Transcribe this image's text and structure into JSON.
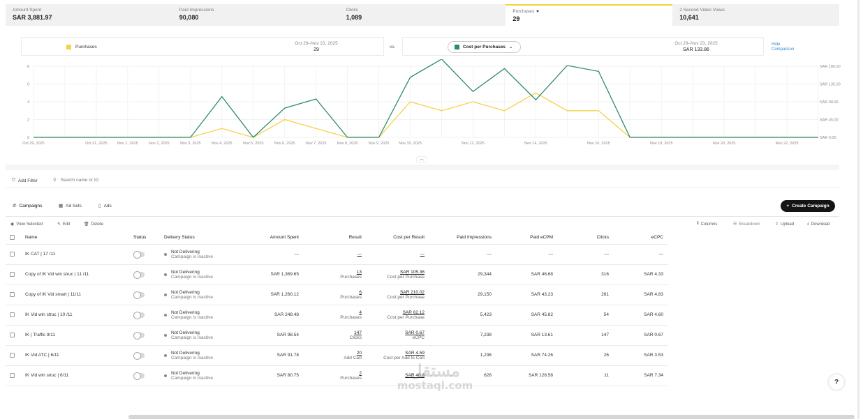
{
  "metrics": [
    {
      "label": "Amount Spent",
      "value": "SAR 3,881.97"
    },
    {
      "label": "Paid Impressions",
      "value": "90,080"
    },
    {
      "label": "Clicks",
      "value": "1,089"
    },
    {
      "label": "Purchases",
      "value": "29"
    },
    {
      "label": "2 Second Video Views",
      "value": "10,641"
    }
  ],
  "comparison": {
    "left_metric": "Purchases",
    "left_period": "Oct 29–Nov 23, 2025",
    "left_value": "29",
    "vs": "vs.",
    "right_metric": "Cost per Purchases",
    "right_period": "Oct 29–Nov 23, 2025",
    "right_value": "SAR 133.86",
    "hide_label": "Hide Comparison"
  },
  "colors": {
    "purchases": "#f3d34a",
    "cost_per_purchase": "#2e8b6e"
  },
  "chart_data": {
    "type": "line",
    "x": [
      "Oct 29, 2025",
      "Oct 30, 2025",
      "Oct 31, 2025",
      "Nov 1, 2025",
      "Nov 2, 2025",
      "Nov 3, 2025",
      "Nov 4, 2025",
      "Nov 5, 2025",
      "Nov 6, 2025",
      "Nov 7, 2025",
      "Nov 8, 2025",
      "Nov 9, 2025",
      "Nov 10, 2025",
      "Nov 11, 2025",
      "Nov 12, 2025",
      "Nov 13, 2025",
      "Nov 14, 2025",
      "Nov 15, 2025",
      "Nov 16, 2025",
      "Nov 17, 2025",
      "Nov 18, 2025",
      "Nov 19, 2025",
      "Nov 20, 2025",
      "Nov 21, 2025",
      "Nov 22, 2025",
      "Nov 23, 2025"
    ],
    "x_tick_labels": [
      "Oct 29, 2025",
      "Oct 31, 2025",
      "Nov 1, 2025",
      "Nov 2, 2025",
      "Nov 3, 2025",
      "Nov 4, 2025",
      "Nov 5, 2025",
      "Nov 6, 2025",
      "Nov 7, 2025",
      "Nov 8, 2025",
      "Nov 9, 2025",
      "Nov 10, 2025",
      "Nov 12, 2025",
      "Nov 14, 2025",
      "Nov 16, 2025",
      "Nov 18, 2025",
      "Nov 20, 2025",
      "Nov 22, 2025"
    ],
    "series": [
      {
        "name": "Purchases",
        "axis": "left",
        "values": [
          0,
          0,
          0,
          0,
          0,
          0,
          1,
          0,
          2,
          1,
          0,
          0,
          4,
          3,
          4,
          3,
          5,
          3,
          3,
          0,
          0,
          0,
          0,
          0,
          0,
          0
        ]
      },
      {
        "name": "Cost per Purchases",
        "axis": "right",
        "values": [
          0,
          0,
          0,
          0,
          0,
          0,
          103,
          0,
          74,
          97,
          0,
          0,
          152,
          198,
          116,
          174,
          95,
          182,
          167,
          0,
          0,
          0,
          0,
          0,
          0,
          0
        ]
      }
    ],
    "ylim_left": [
      0,
      8
    ],
    "yticks_left": [
      "0",
      "2",
      "4",
      "6",
      "8"
    ],
    "ylim_right": [
      0,
      180
    ],
    "yticks_right": [
      "SAR 0.00",
      "SAR 45.00",
      "SAR 90.00",
      "SAR 135.00",
      "SAR 180.00"
    ],
    "grid": true
  },
  "toolbar": {
    "add_filter": "Add Filter",
    "search_placeholder": "Search name or ID"
  },
  "tabs": [
    "Campaigns",
    "Ad Sets",
    "Ads"
  ],
  "create_label": "Create Campaign",
  "actions": {
    "view": "View Selected",
    "edit": "Edit",
    "delete": "Delete",
    "columns": "Columns",
    "breakdown": "Breakdown",
    "upload": "Upload",
    "download": "Download"
  },
  "table": {
    "headers": [
      "Name",
      "Status",
      "Delivery Status",
      "Amount Spent",
      "Result",
      "Cost per Result",
      "Paid Impressions",
      "Paid eCPM",
      "Clicks",
      "eCPC"
    ],
    "rows": [
      {
        "name": "IK CAT | 17 /11",
        "del1": "Not Delivering",
        "del2": "Campaign is inactive",
        "spent": "—",
        "res": "—",
        "res_sub": "",
        "cpr": "—",
        "cpr_sub": "",
        "impr": "—",
        "ecpm": "—",
        "clicks": "—",
        "ecpc": "—"
      },
      {
        "name": "Copy of IK Vid win struc | 11 /11",
        "del1": "Not Delivering",
        "del2": "Campaign is inactive",
        "spent": "SAR 1,369.65",
        "res": "13",
        "res_sub": "Purchases",
        "cpr": "SAR 105.36",
        "cpr_sub": "Cost per Purchase",
        "impr": "29,344",
        "ecpm": "SAR 46.68",
        "clicks": "316",
        "ecpc": "SAR 4.33"
      },
      {
        "name": "Copy of IK Vid smart | 11/11",
        "del1": "Not Delivering",
        "del2": "Campaign is inactive",
        "spent": "SAR 1,260.12",
        "res": "6",
        "res_sub": "Purchases",
        "cpr": "SAR 210.02",
        "cpr_sub": "Cost per Purchase",
        "impr": "29,150",
        "ecpm": "SAR 43.23",
        "clicks": "261",
        "ecpc": "SAR 4.83"
      },
      {
        "name": "IK Vid win struc | 10 /11",
        "del1": "Not Delivering",
        "del2": "Campaign is inactive",
        "spent": "SAR 248.48",
        "res": "4",
        "res_sub": "Purchases",
        "cpr": "SAR 62.12",
        "cpr_sub": "Cost per Purchase",
        "impr": "5,423",
        "ecpm": "SAR 45.82",
        "clicks": "54",
        "ecpc": "SAR 4.60"
      },
      {
        "name": "IK | Traffic 9/11",
        "del1": "Not Delivering",
        "del2": "Campaign is inactive",
        "spent": "SAR 98.54",
        "res": "147",
        "res_sub": "Clicks",
        "cpr": "SAR 0.67",
        "cpr_sub": "eCPC",
        "impr": "7,238",
        "ecpm": "SAR 13.61",
        "clicks": "147",
        "ecpc": "SAR 0.67"
      },
      {
        "name": "IK Vid ATC | 6/11",
        "del1": "Not Delivering",
        "del2": "Campaign is inactive",
        "spent": "SAR 91.78",
        "res": "20",
        "res_sub": "Add Cart",
        "cpr": "SAR 4.59",
        "cpr_sub": "Cost per Add to Cart",
        "impr": "1,236",
        "ecpm": "SAR 74.26",
        "clicks": "26",
        "ecpc": "SAR 3.53"
      },
      {
        "name": "IK Vid win struc | 6/11",
        "del1": "Not Delivering",
        "del2": "Campaign is inactive",
        "spent": "SAR 80.75",
        "res": "2",
        "res_sub": "Purchases",
        "cpr": "SAR 40.3",
        "cpr_sub": "",
        "impr": "628",
        "ecpm": "SAR 128.58",
        "clicks": "11",
        "ecpc": "SAR 7.34"
      }
    ]
  },
  "watermark": {
    "arabic": "مستقل",
    "latin": "mostaql.com"
  }
}
